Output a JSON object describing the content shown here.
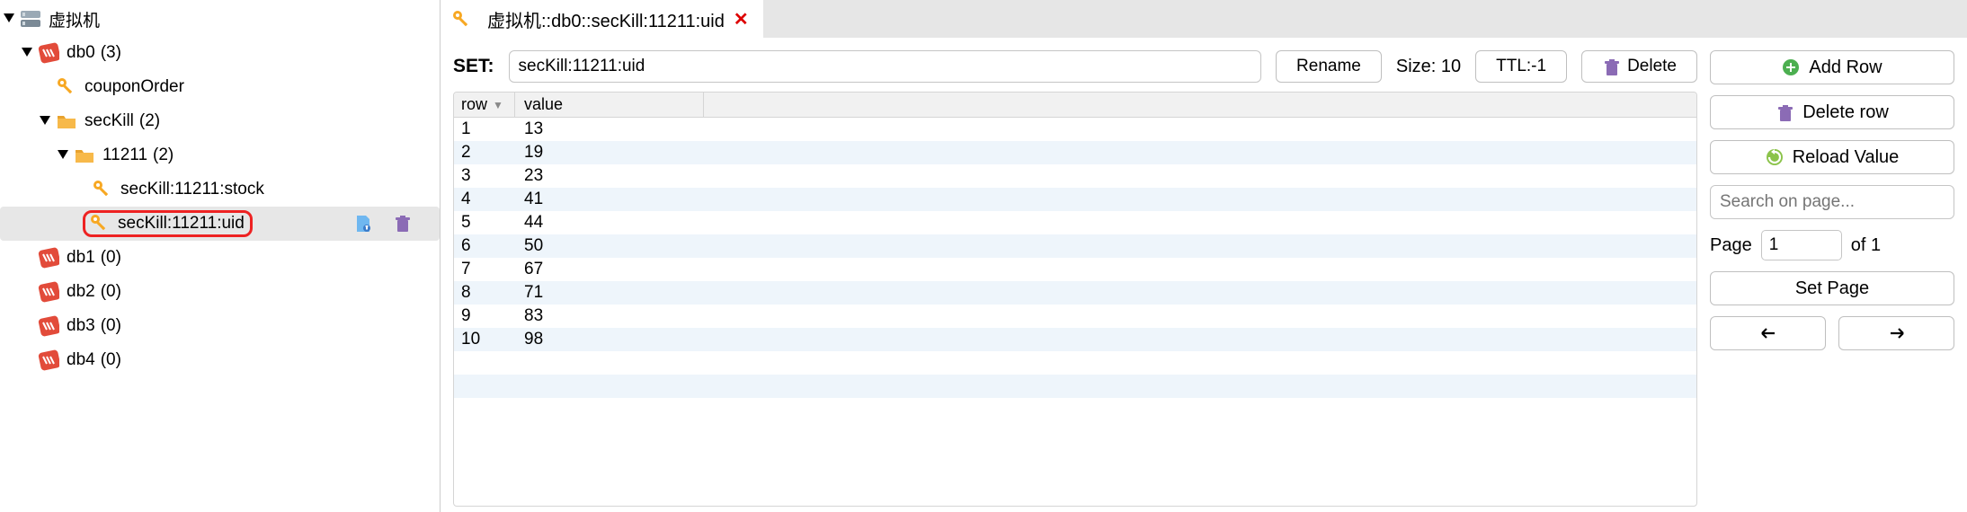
{
  "tree": {
    "server": {
      "label": "虚拟机"
    },
    "db0": {
      "label": "db0",
      "count": "(3)"
    },
    "couponOrder": {
      "label": "couponOrder"
    },
    "secKill": {
      "label": "secKill",
      "count": "(2)"
    },
    "folder11211": {
      "label": "11211",
      "count": "(2)"
    },
    "keyStock": {
      "label": "secKill:11211:stock"
    },
    "keyUid": {
      "label": "secKill:11211:uid"
    },
    "db1": {
      "label": "db1",
      "count": "(0)"
    },
    "db2": {
      "label": "db2",
      "count": "(0)"
    },
    "db3": {
      "label": "db3",
      "count": "(0)"
    },
    "db4": {
      "label": "db4",
      "count": "(0)"
    }
  },
  "tab": {
    "title": "虚拟机::db0::secKill:11211:uid"
  },
  "toolbar": {
    "type_label": "SET:",
    "key_value": "secKill:11211:uid",
    "rename": "Rename",
    "size_label": "Size: 10",
    "ttl": "TTL:-1",
    "delete": "Delete"
  },
  "table": {
    "headers": {
      "row": "row",
      "value": "value"
    },
    "rows": [
      {
        "row": "1",
        "value": "13"
      },
      {
        "row": "2",
        "value": "19"
      },
      {
        "row": "3",
        "value": "23"
      },
      {
        "row": "4",
        "value": "41"
      },
      {
        "row": "5",
        "value": "44"
      },
      {
        "row": "6",
        "value": "50"
      },
      {
        "row": "7",
        "value": "67"
      },
      {
        "row": "8",
        "value": "71"
      },
      {
        "row": "9",
        "value": "83"
      },
      {
        "row": "10",
        "value": "98"
      }
    ]
  },
  "actions": {
    "add_row": "Add Row",
    "delete_row": "Delete row",
    "reload": "Reload Value",
    "search_placeholder": "Search on page...",
    "page_label": "Page",
    "page_value": "1",
    "of_label": "of 1",
    "set_page": "Set Page"
  }
}
